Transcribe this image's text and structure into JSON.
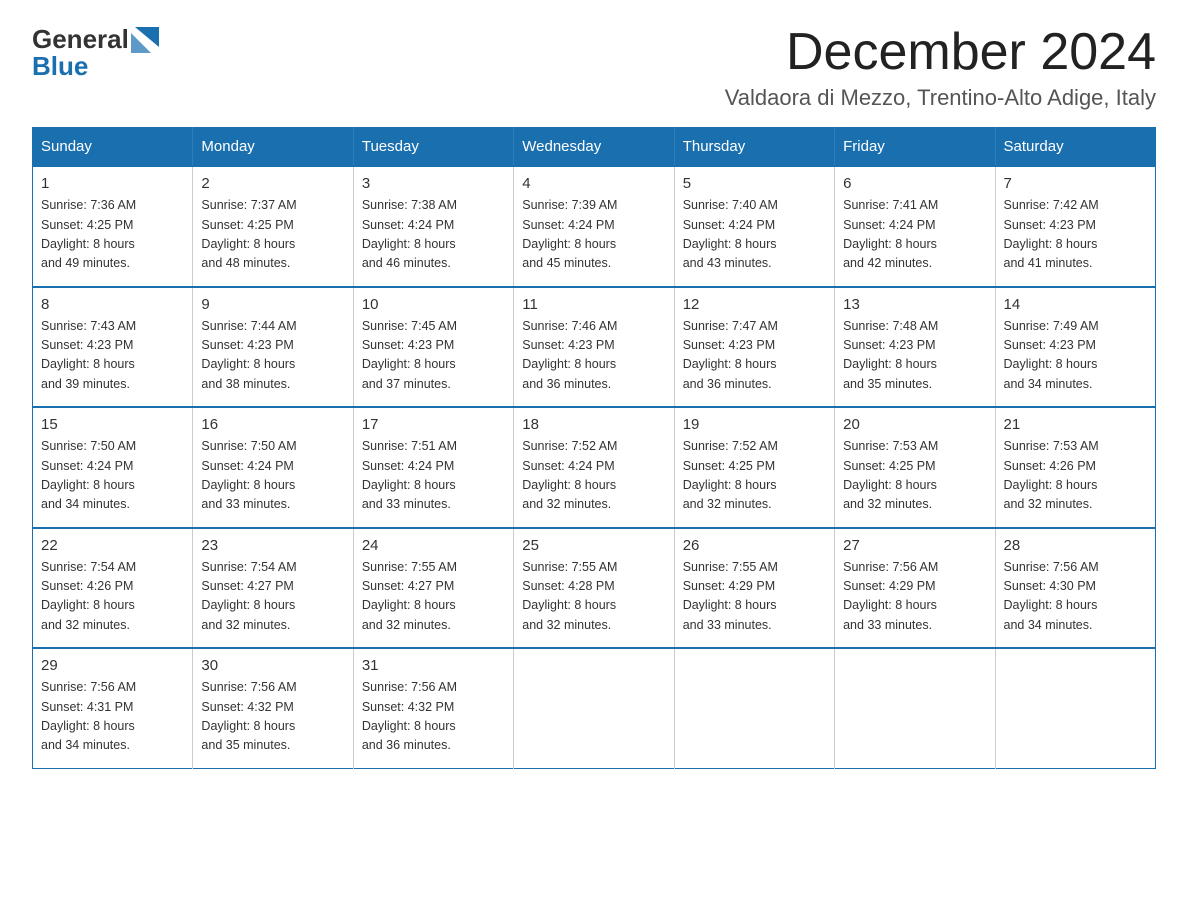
{
  "header": {
    "logo_general": "General",
    "logo_blue": "Blue",
    "month_title": "December 2024",
    "location": "Valdaora di Mezzo, Trentino-Alto Adige, Italy"
  },
  "days_of_week": [
    "Sunday",
    "Monday",
    "Tuesday",
    "Wednesday",
    "Thursday",
    "Friday",
    "Saturday"
  ],
  "weeks": [
    [
      {
        "date": "1",
        "sunrise": "7:36 AM",
        "sunset": "4:25 PM",
        "daylight": "8 hours and 49 minutes."
      },
      {
        "date": "2",
        "sunrise": "7:37 AM",
        "sunset": "4:25 PM",
        "daylight": "8 hours and 48 minutes."
      },
      {
        "date": "3",
        "sunrise": "7:38 AM",
        "sunset": "4:24 PM",
        "daylight": "8 hours and 46 minutes."
      },
      {
        "date": "4",
        "sunrise": "7:39 AM",
        "sunset": "4:24 PM",
        "daylight": "8 hours and 45 minutes."
      },
      {
        "date": "5",
        "sunrise": "7:40 AM",
        "sunset": "4:24 PM",
        "daylight": "8 hours and 43 minutes."
      },
      {
        "date": "6",
        "sunrise": "7:41 AM",
        "sunset": "4:24 PM",
        "daylight": "8 hours and 42 minutes."
      },
      {
        "date": "7",
        "sunrise": "7:42 AM",
        "sunset": "4:23 PM",
        "daylight": "8 hours and 41 minutes."
      }
    ],
    [
      {
        "date": "8",
        "sunrise": "7:43 AM",
        "sunset": "4:23 PM",
        "daylight": "8 hours and 39 minutes."
      },
      {
        "date": "9",
        "sunrise": "7:44 AM",
        "sunset": "4:23 PM",
        "daylight": "8 hours and 38 minutes."
      },
      {
        "date": "10",
        "sunrise": "7:45 AM",
        "sunset": "4:23 PM",
        "daylight": "8 hours and 37 minutes."
      },
      {
        "date": "11",
        "sunrise": "7:46 AM",
        "sunset": "4:23 PM",
        "daylight": "8 hours and 36 minutes."
      },
      {
        "date": "12",
        "sunrise": "7:47 AM",
        "sunset": "4:23 PM",
        "daylight": "8 hours and 36 minutes."
      },
      {
        "date": "13",
        "sunrise": "7:48 AM",
        "sunset": "4:23 PM",
        "daylight": "8 hours and 35 minutes."
      },
      {
        "date": "14",
        "sunrise": "7:49 AM",
        "sunset": "4:23 PM",
        "daylight": "8 hours and 34 minutes."
      }
    ],
    [
      {
        "date": "15",
        "sunrise": "7:50 AM",
        "sunset": "4:24 PM",
        "daylight": "8 hours and 34 minutes."
      },
      {
        "date": "16",
        "sunrise": "7:50 AM",
        "sunset": "4:24 PM",
        "daylight": "8 hours and 33 minutes."
      },
      {
        "date": "17",
        "sunrise": "7:51 AM",
        "sunset": "4:24 PM",
        "daylight": "8 hours and 33 minutes."
      },
      {
        "date": "18",
        "sunrise": "7:52 AM",
        "sunset": "4:24 PM",
        "daylight": "8 hours and 32 minutes."
      },
      {
        "date": "19",
        "sunrise": "7:52 AM",
        "sunset": "4:25 PM",
        "daylight": "8 hours and 32 minutes."
      },
      {
        "date": "20",
        "sunrise": "7:53 AM",
        "sunset": "4:25 PM",
        "daylight": "8 hours and 32 minutes."
      },
      {
        "date": "21",
        "sunrise": "7:53 AM",
        "sunset": "4:26 PM",
        "daylight": "8 hours and 32 minutes."
      }
    ],
    [
      {
        "date": "22",
        "sunrise": "7:54 AM",
        "sunset": "4:26 PM",
        "daylight": "8 hours and 32 minutes."
      },
      {
        "date": "23",
        "sunrise": "7:54 AM",
        "sunset": "4:27 PM",
        "daylight": "8 hours and 32 minutes."
      },
      {
        "date": "24",
        "sunrise": "7:55 AM",
        "sunset": "4:27 PM",
        "daylight": "8 hours and 32 minutes."
      },
      {
        "date": "25",
        "sunrise": "7:55 AM",
        "sunset": "4:28 PM",
        "daylight": "8 hours and 32 minutes."
      },
      {
        "date": "26",
        "sunrise": "7:55 AM",
        "sunset": "4:29 PM",
        "daylight": "8 hours and 33 minutes."
      },
      {
        "date": "27",
        "sunrise": "7:56 AM",
        "sunset": "4:29 PM",
        "daylight": "8 hours and 33 minutes."
      },
      {
        "date": "28",
        "sunrise": "7:56 AM",
        "sunset": "4:30 PM",
        "daylight": "8 hours and 34 minutes."
      }
    ],
    [
      {
        "date": "29",
        "sunrise": "7:56 AM",
        "sunset": "4:31 PM",
        "daylight": "8 hours and 34 minutes."
      },
      {
        "date": "30",
        "sunrise": "7:56 AM",
        "sunset": "4:32 PM",
        "daylight": "8 hours and 35 minutes."
      },
      {
        "date": "31",
        "sunrise": "7:56 AM",
        "sunset": "4:32 PM",
        "daylight": "8 hours and 36 minutes."
      },
      null,
      null,
      null,
      null
    ]
  ],
  "labels": {
    "sunrise": "Sunrise:",
    "sunset": "Sunset:",
    "daylight": "Daylight:"
  }
}
